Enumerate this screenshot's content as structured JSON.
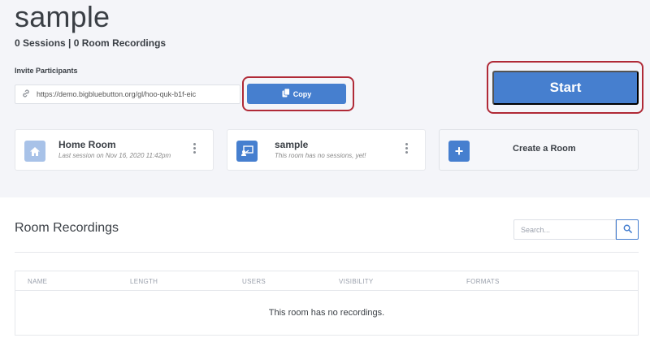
{
  "room": {
    "title": "sample",
    "stats": "0 Sessions | 0 Room Recordings",
    "invite_label": "Invite Participants",
    "invite_url": "https://demo.bigbluebutton.org/gl/hoo-quk-b1f-eic",
    "copy_label": "Copy",
    "start_label": "Start"
  },
  "rooms": [
    {
      "name": "Home Room",
      "subtitle": "Last session on Nov 16, 2020 11:42pm",
      "icon": "home-icon"
    },
    {
      "name": "sample",
      "subtitle": "This room has no sessions, yet!",
      "icon": "presentation-icon"
    }
  ],
  "create_room": {
    "label": "Create a Room",
    "icon": "plus-icon"
  },
  "recordings": {
    "title": "Room Recordings",
    "search_placeholder": "Search...",
    "columns": [
      "NAME",
      "LENGTH",
      "USERS",
      "VISIBILITY",
      "FORMATS"
    ],
    "empty_message": "This room has no recordings."
  },
  "colors": {
    "accent": "#467fcf",
    "highlight": "#b02a37",
    "background": "#f4f5f9"
  }
}
